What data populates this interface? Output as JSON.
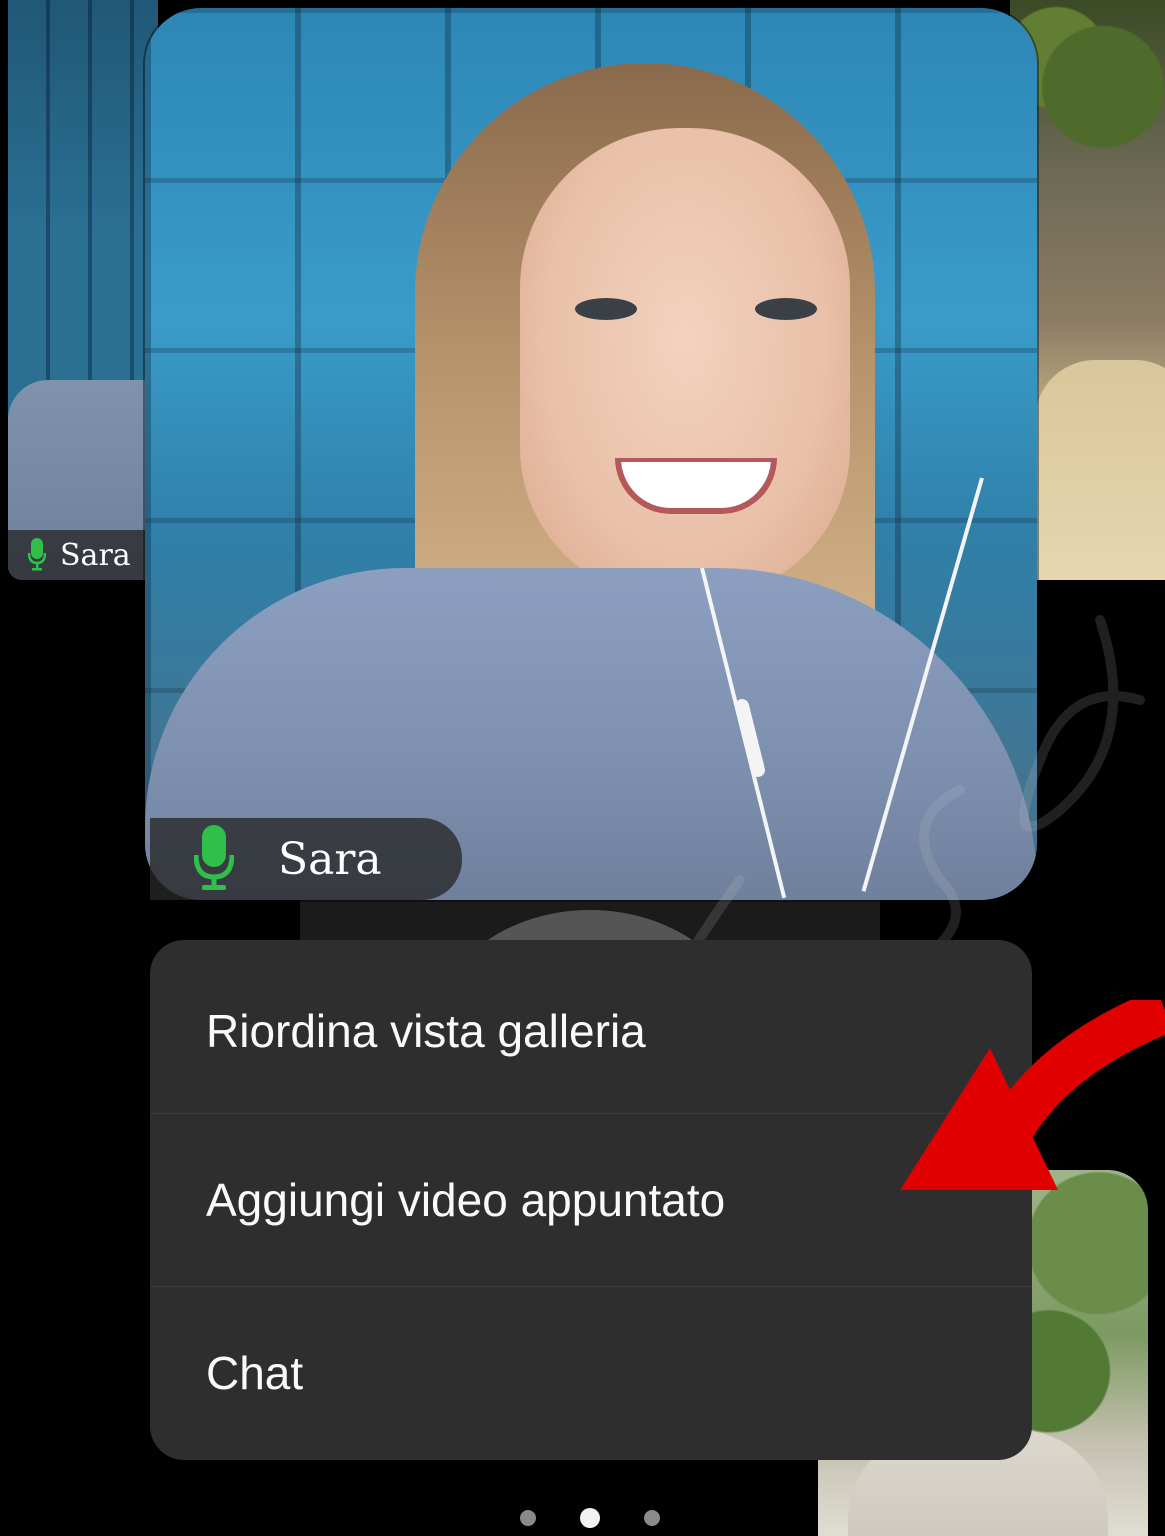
{
  "participants": {
    "main": {
      "name": "Sara",
      "mic_state": "on"
    },
    "thumbnail_left": {
      "name": "Sara",
      "mic_state": "on"
    }
  },
  "context_menu": {
    "items": [
      {
        "label": "Riordina vista galleria"
      },
      {
        "label": "Aggiungi video appuntato"
      },
      {
        "label": "Chat"
      }
    ]
  },
  "pager": {
    "total": 3,
    "current": 2
  },
  "colors": {
    "menu_background": "#2e2e2e",
    "mic_green": "#2fbf4a",
    "arrow_red": "#e00000",
    "page_dot_active": "#f2f2f2",
    "page_dot_inactive": "#8a8a8a"
  }
}
